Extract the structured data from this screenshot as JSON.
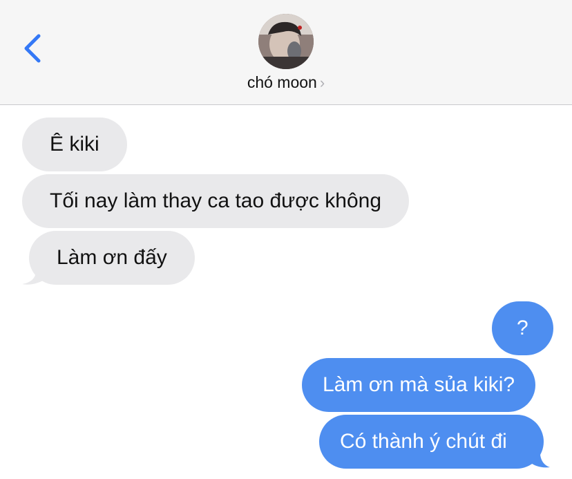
{
  "header": {
    "back_icon": "chevron-left-icon",
    "contact_name": "chó moon",
    "contact_chevron": "›",
    "accent_color": "#3478f6"
  },
  "messages": {
    "received": [
      {
        "text": "Ê kiki"
      },
      {
        "text": "Tối nay làm thay ca tao được không"
      },
      {
        "text": "Làm ơn đấy"
      }
    ],
    "sent": [
      {
        "text": "?"
      },
      {
        "text": "Làm ơn mà sủa kiki?"
      },
      {
        "text": "Có thành ý chút đi"
      }
    ]
  },
  "colors": {
    "received_bubble": "#e9e9eb",
    "sent_bubble": "#4e8ef0"
  }
}
